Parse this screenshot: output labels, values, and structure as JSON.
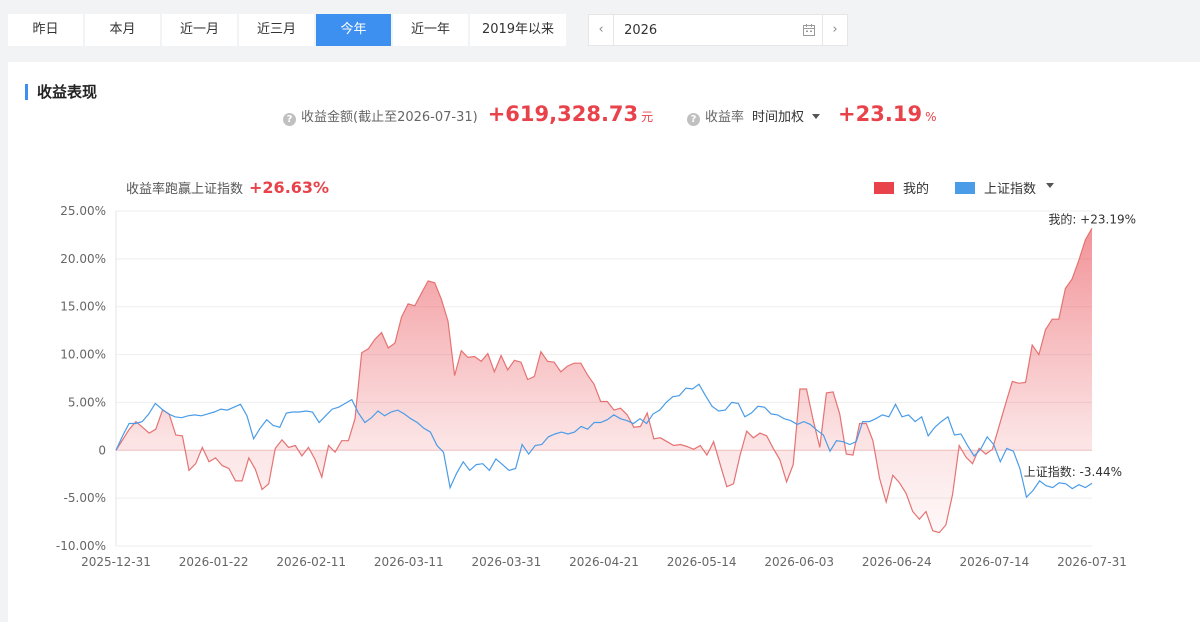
{
  "period_tabs": [
    {
      "label": "昨日",
      "active": false
    },
    {
      "label": "本月",
      "active": false
    },
    {
      "label": "近一月",
      "active": false
    },
    {
      "label": "近三月",
      "active": false
    },
    {
      "label": "今年",
      "active": true
    },
    {
      "label": "近一年",
      "active": false
    },
    {
      "label": "2019年以来",
      "active": false
    }
  ],
  "date_picker": {
    "value": "2026",
    "prev_icon": "chevron-left-icon",
    "next_icon": "chevron-right-icon",
    "calendar_icon": "calendar-icon"
  },
  "panel": {
    "title": "收益表现",
    "profit": {
      "label": "收益金额(截止至2026-07-31)",
      "value": "+619,328.73",
      "unit": "元"
    },
    "rate": {
      "label": "收益率",
      "method": "时间加权",
      "value": "+23.19",
      "unit": "%"
    },
    "beat": {
      "label": "收益率跑赢上证指数",
      "value": "+26.63%"
    },
    "legend": {
      "mine": "我的",
      "index": "上证指数"
    }
  },
  "colors": {
    "accent": "#3d8ff0",
    "mine": "#e8424a",
    "mine_line": "#e57373",
    "index": "#4a9ce8"
  },
  "chart_data": {
    "type": "line",
    "x_tick_labels": [
      "2025-12-31",
      "2026-01-22",
      "2026-02-11",
      "2026-03-11",
      "2026-03-31",
      "2026-04-21",
      "2026-05-14",
      "2026-06-03",
      "2026-06-24",
      "2026-07-14",
      "2026-07-31"
    ],
    "y_tick_labels": [
      "25.00%",
      "20.00%",
      "15.00%",
      "10.00%",
      "5.00%",
      "0",
      "-5.00%",
      "-10.00%"
    ],
    "ylim": [
      -10,
      25
    ],
    "ylabel_unit": "%",
    "grid": true,
    "legend_position": "top-right",
    "end_labels": {
      "mine": "我的: +23.19%",
      "index": "上证指数: -3.44%"
    },
    "series": [
      {
        "name": "我的",
        "area": true,
        "values": [
          0,
          1.1,
          2.2,
          3,
          2.4,
          1.8,
          2.2,
          4.2,
          3.8,
          1.6,
          1.5,
          -2.1,
          -1.4,
          0.3,
          -1.2,
          -0.8,
          -1.6,
          -1.9,
          -3.2,
          -3.2,
          -0.8,
          -2,
          -4.1,
          -3.5,
          0.2,
          1.1,
          0.3,
          0.5,
          -0.6,
          0.3,
          -1,
          -2.8,
          0.5,
          -0.2,
          1,
          1,
          3.3,
          10.2,
          10.6,
          11.6,
          12.3,
          10.7,
          11.2,
          13.9,
          15.3,
          15.1,
          16.4,
          17.7,
          17.5,
          15.8,
          13.5,
          7.8,
          10.4,
          9.7,
          9.8,
          9.3,
          10.1,
          8.2,
          9.9,
          8.4,
          9.4,
          9.2,
          7.4,
          7.7,
          10.3,
          9.3,
          9.2,
          8.2,
          8.8,
          9.1,
          9.1,
          7.9,
          6.9,
          5.1,
          5.1,
          4.2,
          4.4,
          3.7,
          2.4,
          2.5,
          3.9,
          1.2,
          1.3,
          0.9,
          0.5,
          0.6,
          0.4,
          0.1,
          0.5,
          -0.5,
          0.9,
          -1.5,
          -3.8,
          -3.5,
          -0.5,
          2,
          1.3,
          1.8,
          1.5,
          0.2,
          -1,
          -3.3,
          -1.5,
          6.4,
          6.4,
          3.2,
          0.3,
          6,
          6.1,
          3.8,
          -0.4,
          -0.5,
          2.8,
          2.8,
          1,
          -2.9,
          -5.4,
          -2.6,
          -3.4,
          -4.5,
          -6.4,
          -7.2,
          -6.4,
          -8.4,
          -8.6,
          -7.8,
          -4.6,
          0.5,
          -0.7,
          -1.4,
          0.2,
          -0.4,
          0.1,
          2.5,
          4.9,
          7.2,
          7,
          7.1,
          11,
          10,
          12.6,
          13.7,
          13.7,
          16.9,
          17.9,
          19.8,
          22,
          23.19
        ]
      },
      {
        "name": "上证指数",
        "area": false,
        "values": [
          0,
          1.5,
          2.8,
          2.8,
          3,
          3.8,
          4.9,
          4.3,
          3.8,
          3.5,
          3.4,
          3.6,
          3.7,
          3.6,
          3.8,
          4,
          4.3,
          4.2,
          4.5,
          4.8,
          3.6,
          1.2,
          2.3,
          3.2,
          2.6,
          2.4,
          3.9,
          4,
          4,
          4.1,
          4,
          2.9,
          3.6,
          4.3,
          4.5,
          4.9,
          5.3,
          3.9,
          2.9,
          3.4,
          4.1,
          3.6,
          4,
          4.2,
          3.8,
          3.3,
          2.9,
          2.3,
          1.9,
          0.5,
          -0.2,
          -3.9,
          -2.4,
          -1.2,
          -2.1,
          -1.5,
          -1.4,
          -2.1,
          -0.9,
          -1.5,
          -2.1,
          -1.9,
          0.6,
          -0.4,
          0.5,
          0.6,
          1.4,
          1.7,
          1.9,
          1.7,
          1.9,
          2.5,
          2.2,
          2.9,
          2.9,
          3.2,
          3.7,
          3.3,
          3.1,
          2.8,
          3.3,
          2.8,
          3.8,
          4.2,
          5,
          5.6,
          5.7,
          6.5,
          6.4,
          6.9,
          5.7,
          4.6,
          4.1,
          4.2,
          5,
          4.9,
          3.5,
          3.9,
          4.6,
          4.5,
          3.8,
          3.7,
          3.3,
          3.1,
          2.7,
          3,
          2.7,
          2.1,
          1.6,
          -0.1,
          1,
          0.9,
          0.6,
          0.9,
          3,
          3,
          3.3,
          3.7,
          3.5,
          4.8,
          3.5,
          3.7,
          3,
          3.5,
          1.5,
          2.4,
          3,
          3.5,
          1.6,
          1.7,
          0.5,
          -0.6,
          0.1,
          1.4,
          0.6,
          -1.2,
          0.2,
          -0.1,
          -1.9,
          -4.9,
          -4.2,
          -3.2,
          -3.7,
          -3.9,
          -3.4,
          -3.5,
          -4,
          -3.6,
          -3.9,
          -3.44
        ]
      }
    ]
  }
}
